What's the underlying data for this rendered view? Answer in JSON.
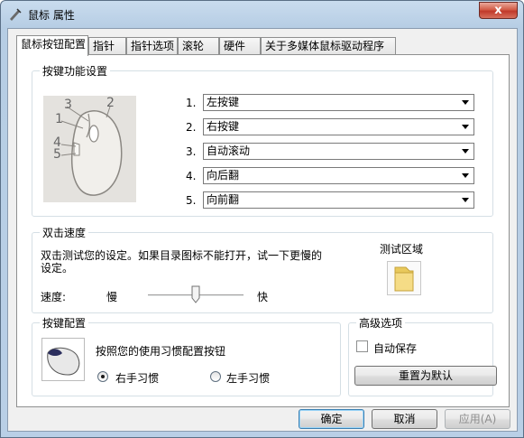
{
  "window": {
    "title": "鼠标 属性",
    "close_label": "x"
  },
  "tabs": [
    {
      "label": "鼠标按钮配置",
      "active": true
    },
    {
      "label": "指针",
      "active": false
    },
    {
      "label": "指针选项",
      "active": false
    },
    {
      "label": "滚轮",
      "active": false
    },
    {
      "label": "硬件",
      "active": false
    },
    {
      "label": "关于多媒体鼠标驱动程序",
      "active": false
    }
  ],
  "button_functions": {
    "title": "按键功能设置",
    "diagram_labels": [
      "1",
      "2",
      "3",
      "4",
      "5"
    ],
    "rows": [
      {
        "num": "1.",
        "value": "左按键"
      },
      {
        "num": "2.",
        "value": "右按键"
      },
      {
        "num": "3.",
        "value": "自动滚动"
      },
      {
        "num": "4.",
        "value": "向后翻"
      },
      {
        "num": "5.",
        "value": "向前翻"
      }
    ]
  },
  "double_click": {
    "title": "双击速度",
    "description_line1": "双击测试您的设定。如果目录图标不能打开，试一下更慢的",
    "description_line2": "设定。",
    "test_area_label": "测试区域",
    "speed_label": "速度:",
    "slow_label": "慢",
    "fast_label": "快",
    "speed_level_fraction": 0.5
  },
  "button_config": {
    "title": "按键配置",
    "description": "按照您的使用习惯配置按钮",
    "right_hand_label": "右手习惯",
    "left_hand_label": "左手习惯",
    "selected": "right"
  },
  "advanced": {
    "title": "高级选项",
    "autosave_label": "自动保存",
    "autosave_checked": false,
    "reset_label": "重置为默认"
  },
  "footer": {
    "ok_label": "确定",
    "cancel_label": "取消",
    "apply_label": "应用(A)"
  },
  "colors": {
    "accent": "#3c7fb1",
    "close": "#c0392b",
    "folder": "#e9c95c"
  }
}
